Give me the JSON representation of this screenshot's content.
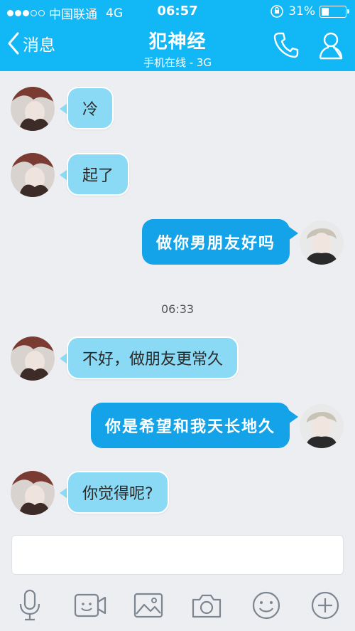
{
  "status_bar": {
    "carrier": "中国联通",
    "network": "4G",
    "time": "06:57",
    "battery": "31%",
    "battery_level": 0.31
  },
  "header": {
    "back_label": "消息",
    "title": "犯神经",
    "subtitle": "手机在线 - 3G"
  },
  "messages": [
    {
      "side": "in",
      "text": "冷"
    },
    {
      "side": "in",
      "text": "起了"
    },
    {
      "side": "out",
      "text": "做你男朋友好吗"
    },
    {
      "side": "in",
      "text": "不好，做朋友更常久"
    },
    {
      "side": "out",
      "text": "你是希望和我天长地久"
    },
    {
      "side": "in",
      "text": "你觉得呢?"
    }
  ],
  "timestamp": "06:33",
  "colors": {
    "header": "#12b7f5",
    "incoming_bubble": "#8ad9f5",
    "outgoing_bubble": "#14a3e8",
    "background": "#eceef2"
  },
  "toolbar_icons": [
    "microphone-icon",
    "video-icon",
    "image-icon",
    "camera-icon",
    "emoji-icon",
    "add-icon"
  ]
}
